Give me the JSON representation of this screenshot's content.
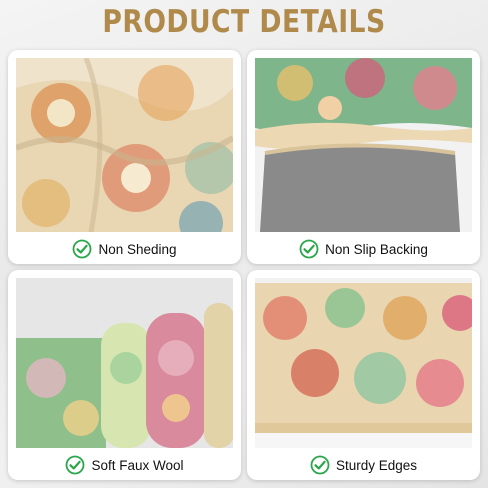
{
  "page": {
    "title": "PRODUCT DETAILS"
  },
  "cards": [
    {
      "label": "Non Sheding",
      "icon": "check-circle-icon"
    },
    {
      "label": "Non Slip Backing",
      "icon": "check-circle-icon"
    },
    {
      "label": "Soft Faux Wool",
      "icon": "check-circle-icon"
    },
    {
      "label": "Sturdy Edges",
      "icon": "check-circle-icon"
    }
  ],
  "colors": {
    "title": "#b08a4a",
    "check": "#2aa64a",
    "caption": "#111111"
  }
}
